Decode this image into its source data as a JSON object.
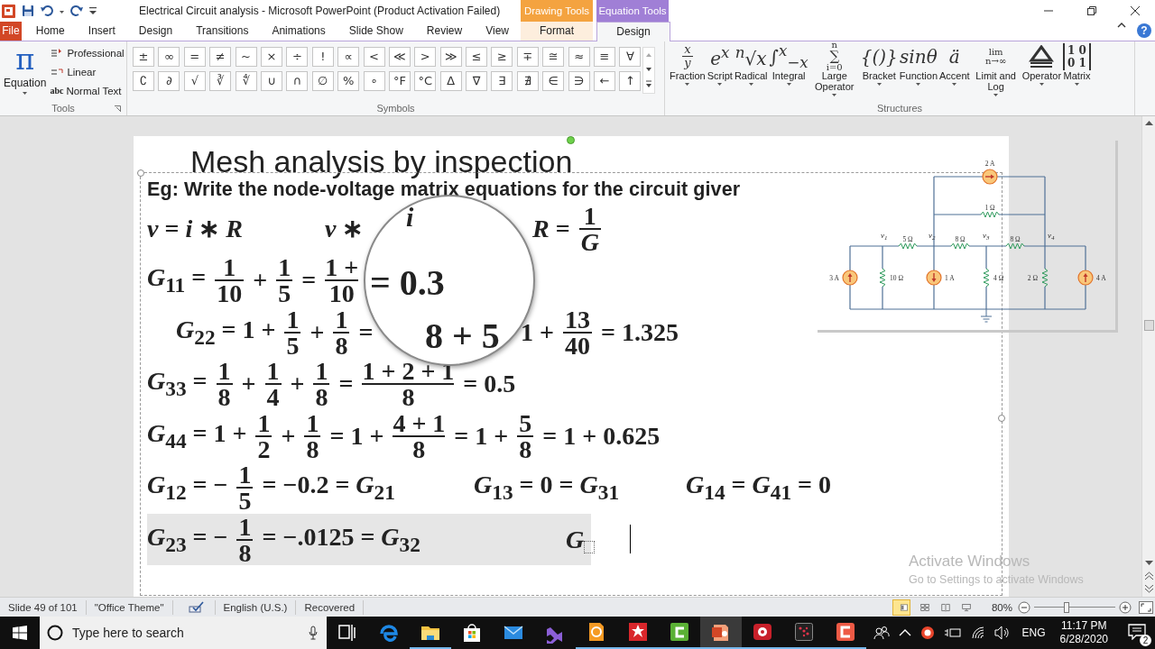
{
  "window": {
    "title": "Electrical Circuit analysis  -  Microsoft PowerPoint (Product Activation Failed)",
    "contextual": [
      {
        "label": "Drawing Tools",
        "color": "#f4a340"
      },
      {
        "label": "Equation Tools",
        "color": "#a07fd6"
      }
    ],
    "help": "?"
  },
  "tabs": [
    {
      "label": "File",
      "kind": "file",
      "selected": false
    },
    {
      "label": "Home",
      "kind": "normal",
      "selected": false
    },
    {
      "label": "Insert",
      "kind": "normal",
      "selected": false
    },
    {
      "label": "Design",
      "kind": "normal",
      "selected": false
    },
    {
      "label": "Transitions",
      "kind": "normal",
      "selected": false
    },
    {
      "label": "Animations",
      "kind": "normal",
      "selected": false
    },
    {
      "label": "Slide Show",
      "kind": "normal",
      "selected": false
    },
    {
      "label": "Review",
      "kind": "normal",
      "selected": false
    },
    {
      "label": "View",
      "kind": "normal",
      "selected": false
    },
    {
      "label": "Format",
      "kind": "drawing",
      "selected": false
    },
    {
      "label": "Design",
      "kind": "equation",
      "selected": true
    }
  ],
  "ribbon": {
    "tools": {
      "label": "Tools",
      "equation": {
        "glyph": "π",
        "label": "Equation"
      },
      "options": [
        {
          "kind": "professional",
          "label": "Professional"
        },
        {
          "kind": "linear",
          "label": "Linear"
        },
        {
          "kind": "normal",
          "glyph": "abc",
          "label": "Normal Text"
        }
      ]
    },
    "symbols": {
      "label": "Symbols",
      "rows": [
        [
          "±",
          "∞",
          "=",
          "≠",
          "~",
          "×",
          "÷",
          "!",
          "∝",
          "<",
          "≪",
          ">",
          "≫",
          "≤",
          "≥",
          "∓",
          "≅",
          "≈",
          "≡",
          "∀"
        ],
        [
          "∁",
          "∂",
          "√",
          "∛",
          "∜",
          "∪",
          "∩",
          "∅",
          "%",
          "∘",
          "°F",
          "°C",
          "∆",
          "∇",
          "∃",
          "∄",
          "∈",
          "∋",
          "←",
          "↑"
        ]
      ]
    },
    "structures": {
      "label": "Structures",
      "items": [
        {
          "label": "Fraction",
          "glyph": {
            "kind": "frac",
            "top": "x",
            "bottom": "y"
          }
        },
        {
          "label": "Script",
          "glyph": {
            "kind": "text",
            "text": "e$^{x}$"
          }
        },
        {
          "label": "Radical",
          "glyph": {
            "kind": "text",
            "text": "$^{n}$√x"
          }
        },
        {
          "label": "Integral",
          "glyph": {
            "kind": "text",
            "text": "∫$^{x}$$_{−x}$"
          }
        },
        {
          "label": "Large Operator",
          "glyph": {
            "kind": "stack",
            "top": "n",
            "middle": "∑",
            "bottom": "i=0"
          }
        },
        {
          "label": "Bracket",
          "glyph": {
            "kind": "text",
            "text": "{()}"
          }
        },
        {
          "label": "Function",
          "glyph": {
            "kind": "text",
            "text": "sinθ"
          }
        },
        {
          "label": "Accent",
          "glyph": {
            "kind": "text",
            "text": "ä"
          }
        },
        {
          "label": "Limit and Log",
          "glyph": {
            "kind": "stack",
            "top": "lim",
            "bottom": "n→∞"
          }
        },
        {
          "label": "Operator",
          "glyph": {
            "kind": "drawing"
          }
        },
        {
          "label": "Matrix",
          "glyph": {
            "kind": "matrix",
            "rows": [
              "1 0",
              "0 1"
            ]
          }
        }
      ]
    }
  },
  "slide": {
    "title": "Mesh analysis by inspection",
    "heading": "Eg: Write the node-voltage matrix equations for the circuit giver",
    "lines": [
      {
        "active": false,
        "groups": [
          [
            {
              "kind": "text",
              "text": "*v* = *i* ∗ *R*"
            }
          ],
          [
            {
              "kind": "text",
              "text": "*v* ∗"
            }
          ],
          [
            {
              "kind": "text",
              "text": "*R* = "
            },
            {
              "kind": "frac",
              "num": "1",
              "den": "*G*"
            }
          ]
        ]
      },
      {
        "active": false,
        "groups": [
          [
            {
              "kind": "text",
              "text": "*G*$_{11}$ = "
            },
            {
              "kind": "frac",
              "num": "1",
              "den": "10"
            },
            {
              "kind": "text",
              "text": " + "
            },
            {
              "kind": "frac",
              "num": "1",
              "den": "5"
            },
            {
              "kind": "text",
              "text": " = "
            },
            {
              "kind": "frac",
              "num": "1 +",
              "den": "10"
            }
          ]
        ]
      },
      {
        "active": false,
        "groups": [
          [
            {
              "kind": "text",
              "text": "*G*$_{22}$ = 1 + "
            },
            {
              "kind": "frac",
              "num": "1",
              "den": "5"
            },
            {
              "kind": "text",
              "text": " + "
            },
            {
              "kind": "frac",
              "num": "1",
              "den": "8"
            },
            {
              "kind": "text",
              "text": " ="
            }
          ],
          [
            {
              "kind": "text",
              "text": "1 + "
            },
            {
              "kind": "frac",
              "num": "13",
              "den": "40"
            },
            {
              "kind": "text",
              "text": " = 1.325"
            }
          ]
        ]
      },
      {
        "active": false,
        "groups": [
          [
            {
              "kind": "text",
              "text": "*G*$_{33}$ = "
            },
            {
              "kind": "frac",
              "num": "1",
              "den": "8"
            },
            {
              "kind": "text",
              "text": " + "
            },
            {
              "kind": "frac",
              "num": "1",
              "den": "4"
            },
            {
              "kind": "text",
              "text": " + "
            },
            {
              "kind": "frac",
              "num": "1",
              "den": "8"
            },
            {
              "kind": "text",
              "text": " = "
            },
            {
              "kind": "frac",
              "num": "1 + 2 + 1",
              "den": "8"
            },
            {
              "kind": "text",
              "text": " = 0.5"
            }
          ]
        ]
      },
      {
        "active": false,
        "groups": [
          [
            {
              "kind": "text",
              "text": "*G*$_{44}$ = 1 + "
            },
            {
              "kind": "frac",
              "num": "1",
              "den": "2"
            },
            {
              "kind": "text",
              "text": " + "
            },
            {
              "kind": "frac",
              "num": "1",
              "den": "8"
            },
            {
              "kind": "text",
              "text": " = 1 + "
            },
            {
              "kind": "frac",
              "num": "4 + 1",
              "den": "8"
            },
            {
              "kind": "text",
              "text": " = 1 + "
            },
            {
              "kind": "frac",
              "num": "5",
              "den": "8"
            },
            {
              "kind": "text",
              "text": " = 1 + 0.625"
            }
          ]
        ]
      },
      {
        "active": false,
        "groups": [
          [
            {
              "kind": "text",
              "text": "*G*$_{12}$ = − "
            },
            {
              "kind": "frac",
              "num": "1",
              "den": "5"
            },
            {
              "kind": "text",
              "text": " = −0.2 = *G*$_{21}$"
            }
          ],
          [
            {
              "kind": "text",
              "text": "*G*$_{13}$ = 0 = *G*$_{31}$"
            }
          ],
          [
            {
              "kind": "text",
              "text": "*G*$_{14}$ = *G*$_{41}$ = 0"
            }
          ]
        ]
      },
      {
        "active": true,
        "groups": [
          [
            {
              "kind": "text",
              "text": "*G*$_{23}$ = − "
            },
            {
              "kind": "frac",
              "num": "1",
              "den": "8"
            },
            {
              "kind": "text",
              "text": " = −.0125 = *G*$_{32}$"
            }
          ],
          [
            {
              "kind": "text",
              "text": "*G*"
            },
            {
              "kind": "slot"
            }
          ]
        ]
      }
    ],
    "magnifier": [
      "i",
      "= 0.3",
      "8 + 5"
    ],
    "circuit": {
      "sources": [
        {
          "label": "2 A",
          "kind": "right-arrow"
        },
        {
          "label": "3 A",
          "kind": "up-arrow"
        },
        {
          "label": "1 A",
          "kind": "down-arrow"
        },
        {
          "label": "4 A",
          "kind": "up-arrow"
        }
      ],
      "resistors": [
        "1 Ω",
        "5 Ω",
        "8 Ω",
        "8 Ω",
        "10 Ω",
        "4 Ω",
        "2 Ω"
      ],
      "nodes": [
        {
          "v": "v",
          "sub": "1"
        },
        {
          "v": "v",
          "sub": "2"
        },
        {
          "v": "v",
          "sub": "3"
        },
        {
          "v": "v",
          "sub": "4"
        }
      ]
    }
  },
  "activation_notice": {
    "title": "Activate Windows",
    "hint": "Go to Settings to activate Windows"
  },
  "status_bar": {
    "items": [
      {
        "kind": "text",
        "text": "Slide 49 of 101"
      },
      {
        "kind": "text",
        "text": "\"Office Theme\""
      },
      {
        "kind": "spellcheck"
      },
      {
        "kind": "text",
        "text": "English (U.S.)"
      },
      {
        "kind": "text",
        "text": "Recovered"
      }
    ],
    "views": [
      {
        "kind": "normal",
        "selected": true
      },
      {
        "kind": "sorter",
        "selected": false
      },
      {
        "kind": "reading",
        "selected": false
      },
      {
        "kind": "show",
        "selected": false
      }
    ],
    "zoom": "80%",
    "zoom_level": {
      "level": 0.4
    }
  },
  "taskbar": {
    "search": {
      "placeholder": "Type here to search"
    },
    "apps": [
      {
        "kind": "taskview",
        "running": false,
        "selected": false
      },
      {
        "kind": "edge",
        "running": false,
        "selected": false
      },
      {
        "kind": "explorer",
        "running": true,
        "selected": false
      },
      {
        "kind": "store",
        "running": false,
        "selected": false
      },
      {
        "kind": "mail",
        "running": false,
        "selected": false
      },
      {
        "kind": "vs",
        "running": false,
        "selected": false
      },
      {
        "kind": "pdf",
        "running": true,
        "selected": false
      },
      {
        "kind": "star",
        "running": true,
        "selected": false
      },
      {
        "kind": "greenc",
        "running": true,
        "selected": false
      },
      {
        "kind": "powerpoint",
        "running": true,
        "selected": true
      },
      {
        "kind": "camera",
        "running": true,
        "selected": false
      },
      {
        "kind": "dots",
        "running": true,
        "selected": false
      },
      {
        "kind": "redc",
        "running": true,
        "selected": false
      }
    ],
    "language": "ENG",
    "time": "11:17 PM",
    "date": "6/28/2020",
    "notifications": "2"
  }
}
